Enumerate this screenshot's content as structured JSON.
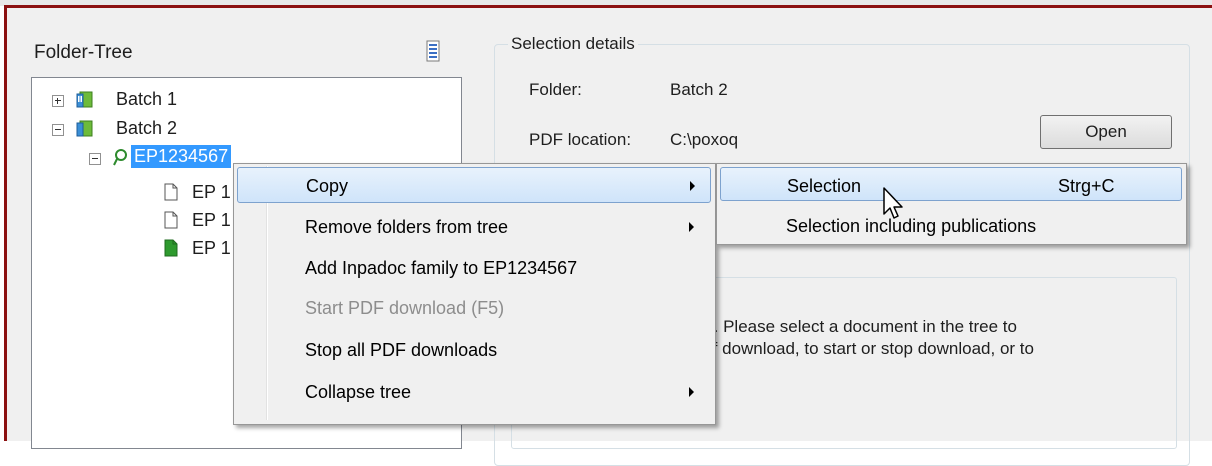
{
  "left_panel": {
    "title": "Folder-Tree",
    "tree": [
      {
        "label": "Batch 1",
        "expander": "plus"
      },
      {
        "label": "Batch 2",
        "expander": "minus"
      },
      {
        "label": "EP1234567",
        "expander": "minus",
        "selected": true
      },
      {
        "label": "EP 1"
      },
      {
        "label": "EP 1"
      },
      {
        "label": "EP 1"
      }
    ]
  },
  "details": {
    "title": "Selection details",
    "folder_label": "Folder:",
    "folder_value": "Batch 2",
    "pdf_label": "PDF location:",
    "pdf_value": "C:\\poxoq",
    "open_button": "Open",
    "info_line1": "ted. Please select a document in the tree to",
    "info_line2": "s of download, to start or stop download, or to"
  },
  "context_menu": {
    "items": [
      {
        "label": "Copy",
        "submenu": true,
        "highlighted": true
      },
      {
        "label": "Remove folders from tree",
        "submenu": true
      },
      {
        "label": "Add Inpadoc family to EP1234567"
      },
      {
        "label": "Start PDF download (F5)",
        "disabled": true
      },
      {
        "label": "Stop all PDF downloads"
      },
      {
        "label": "Collapse tree",
        "submenu": true
      }
    ]
  },
  "submenu": {
    "items": [
      {
        "label": "Selection",
        "shortcut": "Strg+C",
        "highlighted": true
      },
      {
        "label": "Selection including publications",
        "shortcut": ""
      }
    ]
  },
  "colors": {
    "frame": "#8b1010",
    "selection": "#3399ff",
    "menu_highlight_border": "#7da2ce"
  }
}
